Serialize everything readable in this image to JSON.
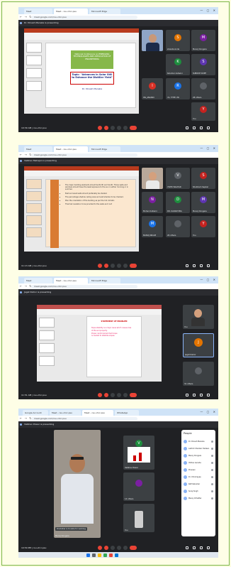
{
  "screenshot1": {
    "tabs": [
      "Meet",
      "Meet - rsu-vhcr-psu",
      "Microsoft Edge"
    ],
    "url": "meet.google.com/rsu-vhcr-psu",
    "presenter_banner": "Dr. Dinesh Meneka is presenting",
    "slide": {
      "header": "National Conference on EMERGING TECHNOLOGIES AND APPLICATION OF ENGINEERING",
      "topic": "Topic: \"Advances in Solar Still to Enhance the Distiller Yield\"",
      "author": "Dr. Dinesh Meneka"
    },
    "tiles": [
      {
        "name": "shweta sinde",
        "initial": "S",
        "color": "#e37400"
      },
      {
        "name": "Manoj Dongare",
        "initial": "M",
        "color": "#7b1fa2"
      },
      {
        "name": "Kalurkar Ashwini",
        "initial": "K",
        "color": "#1e8e3e"
      },
      {
        "name": "SUBODH RUPE",
        "initial": "S",
        "color": "#5e35b1"
      },
      {
        "name": "ISS_ANANDI",
        "initial": "I",
        "color": "#d93025"
      },
      {
        "name": "rhi, THTE, PR",
        "initial": "R",
        "color": "#1a73e8"
      },
      {
        "name": "28 others",
        "initial": "",
        "color": "#5f6368"
      },
      {
        "name": "You",
        "initial": "Y",
        "color": "#c5221f"
      }
    ],
    "time": "10:39 AM | rsu-vhcr-psu"
  },
  "screenshot2": {
    "tabs": [
      "Meet",
      "Meet - rsu-vhcr-psu",
      "Microsoft Edge"
    ],
    "url": "meet.google.com/rsu-vhcr-psu",
    "presenter_banner": "Vaibhav Mahajan is presenting",
    "bullets": [
      "The major building elements should be North and South. Those walls and windows should have the least exposure to the sun in either morning or in summer.",
      "East and west walls should preferably be shaded.",
      "The percentage shadow ceiling area and wall shadow to be checked.",
      "Plan the orientation of the building as per the hot climatic.",
      "Thermal insulation to be provided to the walls and roof."
    ],
    "tiles": [
      {
        "name": "VIVEK WALHAR",
        "initial": "V",
        "color": "#5f6368"
      },
      {
        "name": "Shubham Sapkal",
        "initial": "S",
        "color": "#c5221f"
      },
      {
        "name": "Mohan Kulkarni",
        "initial": "N",
        "color": "#7b1fa2"
      },
      {
        "name": "DR. KADAM PRA",
        "initial": "D",
        "color": "#1e8e3e"
      },
      {
        "name": "Manoj Dongare",
        "initial": "M",
        "color": "#5e35b1"
      },
      {
        "name": "MANOJ NIKAM",
        "initial": "M",
        "color": "#1a73e8"
      },
      {
        "name": "26 others",
        "initial": "",
        "color": "#5f6368"
      },
      {
        "name": "You",
        "initial": "Y",
        "color": "#c5221f"
      }
    ],
    "time": "11:13 AM | rsu-vhcr-psu"
  },
  "screenshot3": {
    "tabs": [
      "Meet",
      "Meet - rsu-vhcr-psu",
      "Microsoft Edge"
    ],
    "url": "meet.google.com/rsu-vhcr-psu",
    "presenter_banner": "Jagat Kishor is presenting",
    "doc_title": "STATEMENT OF PROBLEM",
    "doc_lines": [
      "Slope stability is a major issue which causes loss",
      "of life and property.",
      "Proper reinforcement technique",
      "is needed to stabilize slopes."
    ],
    "tiles": [
      {
        "name": "You",
        "initial": "Y",
        "color": "#1a73e8"
      },
      {
        "name": "Jagat Kishor",
        "initial": "J",
        "color": "#e37400"
      },
      {
        "name": "31 others",
        "initial": "",
        "color": "#5f6368"
      }
    ],
    "time": "11:51 AM | rsu-vhcr-psu"
  },
  "screenshot4": {
    "tabs": [
      "Google Account",
      "Meet - rsu-vhcr-psu",
      "Meet - rsu-vhcr-psu",
      "WhatsApp"
    ],
    "url": "meet.google.com/rsu-vhcr-psu",
    "presenter_banner": "Vaibhav Power is presenting",
    "main_tile_name": "Manoj Dongare",
    "main_tile_status": "Dindulkar is trouble for working",
    "side_tiles": [
      {
        "name": "Vaibhav Power",
        "initial": "V",
        "color": "#1e8e3e"
      },
      {
        "name": "14 others",
        "initial": "",
        "color": "#5f6368"
      },
      {
        "name": "You",
        "initial": "",
        "color": "#5f6368"
      }
    ],
    "people_header": "People",
    "people": [
      "Dr. Dinesh Meneka",
      "Lakhmi Shankar Dadeen",
      "Manoj Dongare",
      "Vibhav Aansha",
      "Praveen",
      "Dr. Chinmayee",
      "Rafi Kaburkar",
      "Suraj Singh",
      "Manoj Chhattar"
    ],
    "time": "10:50 PM | rsu-vhcr-psu"
  }
}
